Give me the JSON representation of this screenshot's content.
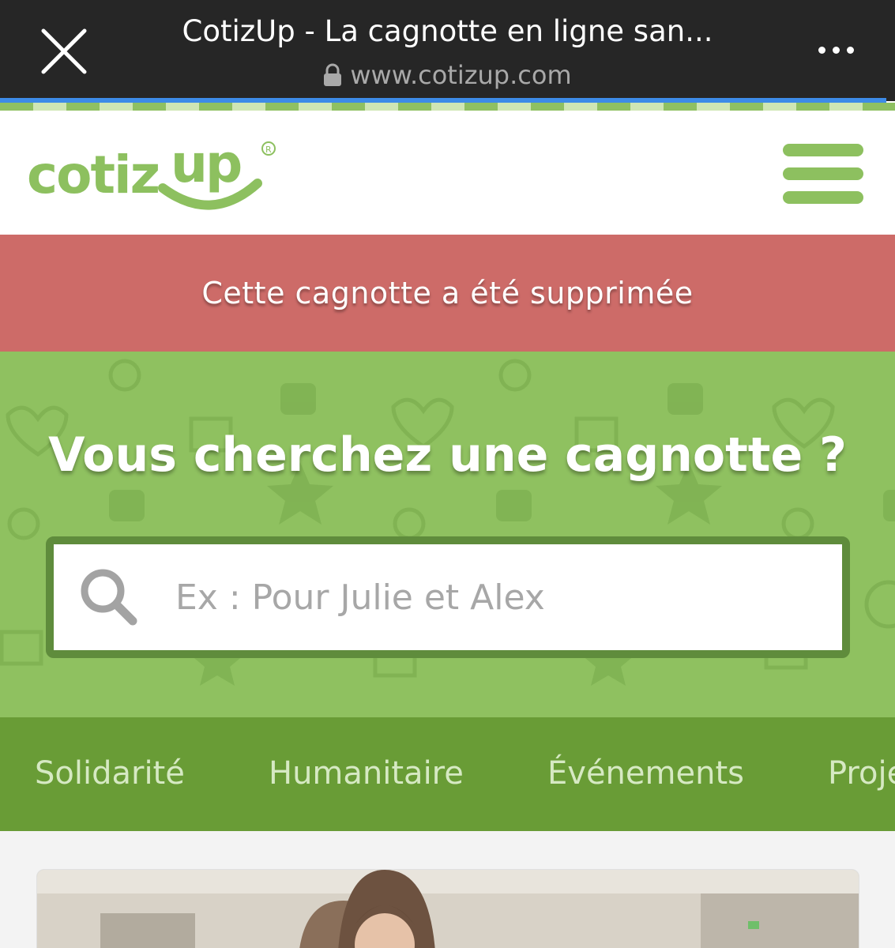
{
  "browser": {
    "page_title": "CotizUp - La cagnotte en ligne san...",
    "url": "www.cotizup.com",
    "progress": 0.99
  },
  "site": {
    "logo_text": "cotizUp",
    "logo_mark": "®"
  },
  "alert": {
    "message": "Cette cagnotte a été supprimée"
  },
  "hero": {
    "title": "Vous cherchez une cagnotte ?",
    "search_placeholder": "Ex : Pour Julie et Alex",
    "search_value": ""
  },
  "categories": [
    "Solidarité",
    "Humanitaire",
    "Événements",
    "Projets"
  ],
  "colors": {
    "brand_green": "#8dc05f",
    "alert_red": "#cd6b68",
    "nav_green": "#699c36",
    "browser_dark": "#262626"
  },
  "icons": {
    "close": "close-icon",
    "more": "more-icon",
    "lock": "lock-icon",
    "menu": "hamburger-icon",
    "search": "search-icon"
  }
}
